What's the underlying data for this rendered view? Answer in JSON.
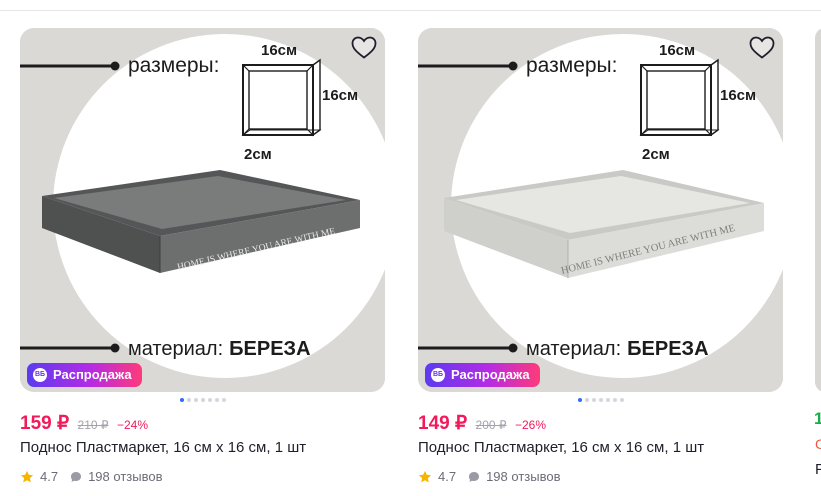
{
  "products": [
    {
      "image": {
        "size_label": "размеры:",
        "dim_width": "16см",
        "dim_height": "16см",
        "dim_depth": "2см",
        "engraving": "HOME IS WHERE YOU ARE WITH ME",
        "material_prefix": "материал:",
        "material_value": "БЕРЕЗА",
        "tray_color": "#6d6e6e"
      },
      "badge": "Распродажа",
      "badge_icon": "ВБ",
      "price": "159 ₽",
      "old_price": "210 ₽",
      "discount": "−24%",
      "title": "Поднос Пластмаркет, 16 см x 16 см, 1 шт",
      "rating": "4.7",
      "reviews": "198 отзывов"
    },
    {
      "image": {
        "size_label": "размеры:",
        "dim_width": "16см",
        "dim_height": "16см",
        "dim_depth": "2см",
        "engraving": "HOME IS WHERE YOU ARE WITH ME",
        "material_prefix": "материал:",
        "material_value": "БЕРЕЗА",
        "tray_color": "#dcdcd8"
      },
      "badge": "Распродажа",
      "badge_icon": "ВБ",
      "price": "149 ₽",
      "old_price": "200 ₽",
      "discount": "−26%",
      "title": "Поднос Пластмаркет, 16 см x 16 см, 1 шт",
      "rating": "4.7",
      "reviews": "198 отзывов"
    }
  ],
  "next_card_peek": {
    "price": "1",
    "sub": "С",
    "title": "F"
  },
  "icons": {
    "favorite": "heart-outline-icon",
    "rating": "star-icon",
    "reviews": "speech-bubble-icon"
  },
  "colors": {
    "price": "#f21a5a",
    "star": "#f7b500",
    "badge_start": "#5b3bf0",
    "badge_end": "#ff3a7a",
    "active_dot": "#2f6bff"
  }
}
